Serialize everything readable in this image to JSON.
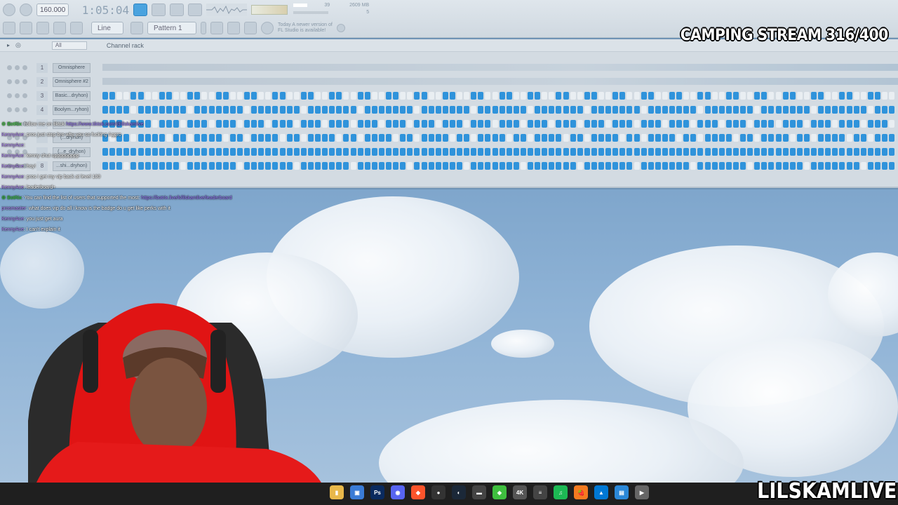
{
  "toolbar": {
    "tempo": "160.000",
    "clock": "1:05:04",
    "pattern": "Pattern 1",
    "snap": "Line",
    "update_notice_line1": "Today  A newer version of",
    "update_notice_line2": "FL Studio is available!",
    "cpu_value": "39",
    "mem_value": "2609 MB",
    "poly_value": "5"
  },
  "rack": {
    "filter": "All",
    "title": "Channel rack",
    "channels": [
      {
        "num": "1",
        "name": "Omnisphere"
      },
      {
        "num": "2",
        "name": "Omnisphere #2"
      },
      {
        "num": "3",
        "name": "Basic...dryhon)"
      },
      {
        "num": "4",
        "name": "Boolym...ryhon)"
      },
      {
        "num": "",
        "name": ""
      },
      {
        "num": "",
        "name": "(...dryhon)"
      },
      {
        "num": "",
        "name": "(...e_dryhon)"
      },
      {
        "num": "8",
        "name": "...shi...dryhon)"
      }
    ]
  },
  "chat": [
    {
      "user": "BotRix",
      "bot": true,
      "text": ": follow me on tiktok ",
      "link": "https://www.tiktok.com/@lilskamlive"
    },
    {
      "user": "KennyAce",
      "bot": false,
      "text": ": pros just stop bro why you so fucking Aggro",
      "link": ""
    },
    {
      "user": "KennyAce",
      "bot": false,
      "text": ":",
      "link": ""
    },
    {
      "user": "KennyAce",
      "bot": false,
      "text": ": kenny shut uppppppppp",
      "link": ""
    },
    {
      "user": "KennyAce",
      "bot": false,
      "text": ": hoy!",
      "link": ""
    },
    {
      "user": "KennyAce",
      "bot": false,
      "text": ": pros i get my vip back at level 100",
      "link": ""
    },
    {
      "user": "KennyAce",
      "bot": false,
      "text": ": leaderboard+",
      "link": ""
    },
    {
      "user": "BotRix",
      "bot": true,
      "text": ": You can find the list of users that supported the most: ",
      "link": "https://botrix.live/k/lilskamlive/leaderboard"
    },
    {
      "user": "prosmaster",
      "bot": false,
      "text": ": what does vip do all i know is the badge do u get like perks with it",
      "link": ""
    },
    {
      "user": "KennyAce",
      "bot": false,
      "text": ": you just get aura",
      "link": ""
    },
    {
      "user": "KennyAce",
      "bot": false,
      "text": ": I can't explain it",
      "link": ""
    }
  ],
  "overlay": {
    "stream_title": "CAMPING STREAM 316/400",
    "watermark": "LILSKAMLIVE"
  },
  "taskbar": {
    "icons": [
      "file-explorer-icon",
      "store-icon",
      "photoshop-icon",
      "discord-icon",
      "brave-icon",
      "obs-icon",
      "steam-icon",
      "keyboard-icon",
      "razer-icon",
      "4k-icon",
      "equalizer-icon",
      "spotify-icon",
      "fl-studio-icon",
      "azure-icon",
      "notes-icon",
      "media-player-icon"
    ]
  },
  "colors": {
    "step_on": "#2f93db",
    "step_off": "#e9eef2",
    "accent": "#4aa3df"
  }
}
